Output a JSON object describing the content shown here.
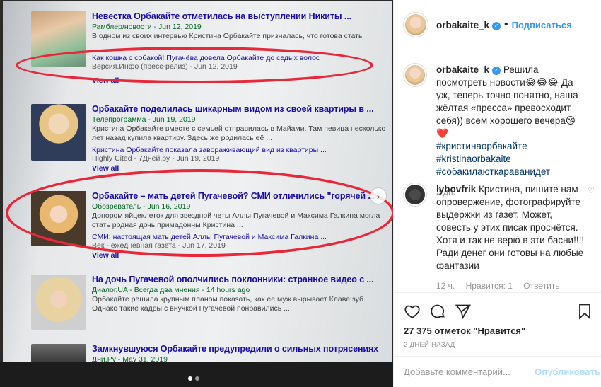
{
  "post": {
    "author": "orbakaite_k",
    "follow_label": "Подписаться",
    "separator": "•",
    "caption": {
      "user": "orbakaite_k",
      "text": "Решила посмотреть новости😂😂😂 Да уж, теперь точно понятно, наша жёлтая «пресса» превосходит себя)) всем хорошего вечера😘❤️",
      "hashtags": [
        "#кристинаорбакайте",
        "#kristinaorbakaite",
        "#собакилаюткараванидет"
      ],
      "time": "2 дн."
    },
    "comments": [
      {
        "user": "lybovfrik",
        "text": "Кристина, пишите нам опровержение, фотографируйте выдержки из газет. Может, совесть у этих писак проснётся. Хотя и так не верю в эти басни!!!! Ради денег они готовы на любые фантазии",
        "time": "12 ч.",
        "likes": "Нравится: 1",
        "reply": "Ответить"
      }
    ],
    "likes_text": "27 375 отметок \"Нравится\"",
    "date_text": "2 ДНЕЙ НАЗАД",
    "comment_placeholder": "Добавьте комментарий...",
    "publish_label": "Опубликовать"
  },
  "screen": {
    "results": [
      {
        "title": "Невестка Орбакайте отметилась на выступлении Никиты ...",
        "source": "Рамблер/новости - Jun 12, 2019",
        "snippet": "В одном из своих интервью Кристина Орбакайте призналась, что готова стать",
        "sub_title": "Как кошка с собакой! Пугачёва довела Орбакайте до седых волос",
        "sub_source": "Версия.Инфо (пресс-релиз) - Jun 12, 2019",
        "view_all": "View all"
      },
      {
        "title": "Орбакайте поделилась шикарным видом из своей квартиры в ...",
        "source": "Телепрограмма - Jun 19, 2019",
        "snippet": "Кристина Орбакайте вместе с семьей отправилась в Майами. Там певица несколько лет назад купила квартиру. Здесь же родилась её ...",
        "sub_title": "Кристина Орбакайте показала завораживающий вид из квартиры ...",
        "sub_source": "Highly Cited - 7Дней.ру - Jun 19, 2019",
        "view_all": "View all"
      },
      {
        "title": "Орбакайте – мать детей Пугачевой? СМИ отличились \"горячей ...",
        "source": "Обозреватель - Jun 16, 2019",
        "snippet": "Донором яйцеклеток для звездной четы Аллы Пугачевой и Максима Галкина могла стать родная дочь примадонны Кристина ...",
        "sub_title": "СМИ: настоящая мать детей Аллы Пугачевой и Максима Галкина ...",
        "sub_source": "Век - ежедневная газета - Jun 17, 2019",
        "view_all": "View all"
      },
      {
        "title": "На дочь Пугачевой ополчились поклонники: странное видео с ...",
        "source": "Диалог.UA - Всегда два мнения - 14 hours ago",
        "snippet": "Орбакайте решила крупным планом показать, как ее муж вырывает Клаве зуб. Однако такие кадры с внучкой Пугачевой понравились ..."
      },
      {
        "title": "Замкнувшуюся Орбакайте предупредили о сильных потрясениях",
        "source": "Дни.Ру - May 31, 2019"
      }
    ]
  },
  "colors": {
    "link_blue": "#1a0dab",
    "source_green": "#006621",
    "ig_blue": "#3897f0",
    "marker_red": "#e8283a"
  }
}
